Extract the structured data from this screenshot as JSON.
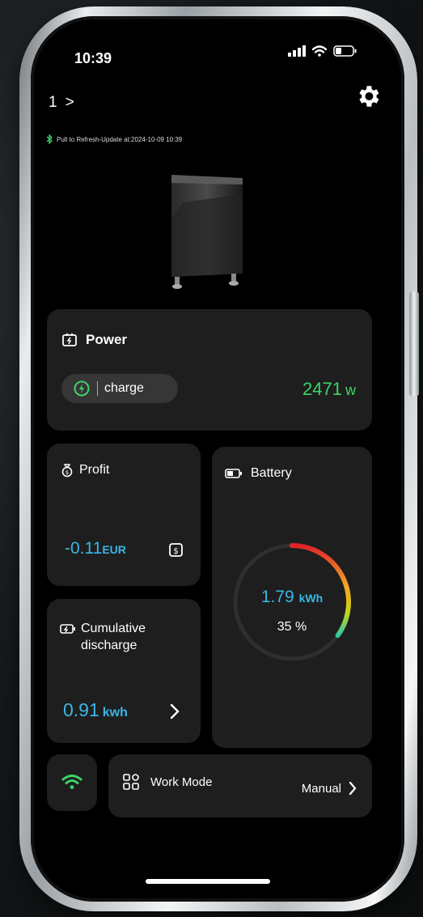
{
  "status_bar": {
    "time": "10:39"
  },
  "header": {
    "device_index": "1",
    "device_chevron": ">"
  },
  "refresh": {
    "text": "Pull to Refresh-Update at:2024-10-09 10:39"
  },
  "power": {
    "title": "Power",
    "state": "charge",
    "value": "2471",
    "unit": "w"
  },
  "profit": {
    "title": "Profit",
    "value": "-0.11",
    "unit": "EUR"
  },
  "battery": {
    "title": "Battery",
    "energy": "1.79",
    "energy_unit": "kWh",
    "percent": "35 %",
    "level": 0.35
  },
  "discharge": {
    "title_line1": "Cumulative",
    "title_line2": "discharge",
    "value": "0.91",
    "unit": "kwh"
  },
  "work_mode": {
    "title": "Work Mode",
    "value": "Manual"
  },
  "colors": {
    "accent_green": "#3fd46a",
    "accent_blue": "#3ab6e6",
    "card_bg": "#1e1e1e"
  }
}
